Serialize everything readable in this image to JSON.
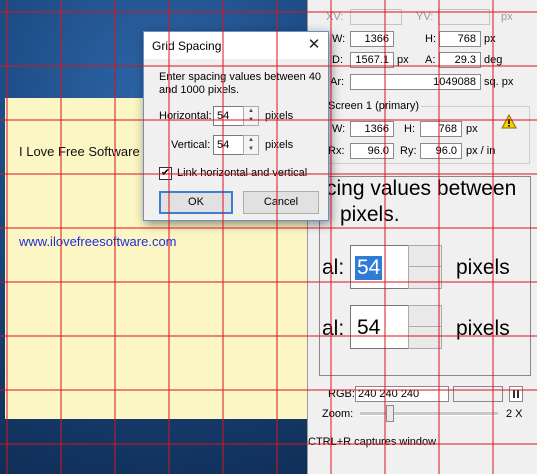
{
  "note": {
    "title": "I Love Free Software",
    "link": "www.ilovefreesoftware.com"
  },
  "panel": {
    "top_labels": {
      "xv": "XV:",
      "yv": "YV:",
      "px": "px"
    },
    "w_label": "W:",
    "w_value": "1366",
    "h_label": "H:",
    "h_value": "768",
    "h_unit": "px",
    "d_label": "D:",
    "d_value": "1567.1",
    "d_unit": "px",
    "a_label": "A:",
    "a_value": "29.3",
    "a_unit": "deg",
    "ar_label": "Ar:",
    "ar_value": "1049088",
    "ar_unit": "sq. px",
    "screen_group": "Screen 1 (primary)",
    "sw_label": "W:",
    "sw_value": "1366",
    "sh_label": "H:",
    "sh_value": "768",
    "sh_unit": "px",
    "rx_label": "Rx:",
    "rx_value": "96.0",
    "ry_label": "Ry:",
    "ry_value": "96.0",
    "ry_unit": "px / in",
    "warning_icon": "warning-icon",
    "magnifier": {
      "line1": "cing values between",
      "line2": "pixels.",
      "row1_prefix": "al:",
      "row1_value": "54",
      "row1_unit": "pixels",
      "row2_prefix": "al:",
      "row2_value": "54",
      "row2_unit": "pixels"
    },
    "rgb_label": "RGB:",
    "rgb_value": "240 240 240",
    "zoom_label": "Zoom:",
    "zoom_value": "2 X",
    "zoom_level": 0.2,
    "footer": "CTRL+R captures window"
  },
  "dialog": {
    "title": "Grid Spacing",
    "close_glyph": "✕",
    "message": "Enter spacing values between 40 and 1000 pixels.",
    "horizontal_label": "Horizontal:",
    "horizontal_value": "54",
    "vertical_label": "Vertical:",
    "vertical_value": "54",
    "unit": "pixels",
    "link_label": "Link horizontal and vertical",
    "link_checked": true,
    "ok_label": "OK",
    "cancel_label": "Cancel"
  },
  "grid": {
    "spacing": "54",
    "color": "#d8141e"
  }
}
